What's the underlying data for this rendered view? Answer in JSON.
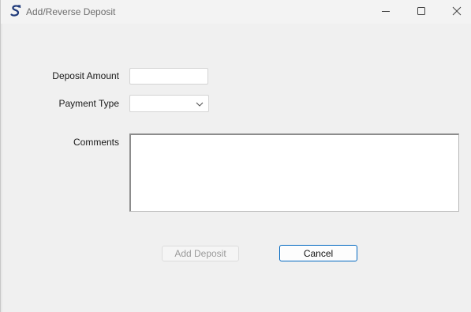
{
  "window": {
    "title": "Add/Reverse Deposit",
    "controls": [
      "minimize-icon",
      "maximize-icon",
      "close-icon"
    ]
  },
  "form": {
    "deposit_amount_label": "Deposit Amount",
    "deposit_amount_value": "",
    "payment_type_label": "Payment Type",
    "payment_type_value": "",
    "comments_label": "Comments",
    "comments_value": ""
  },
  "buttons": {
    "add_deposit_label": "Add Deposit",
    "add_deposit_enabled": false,
    "cancel_label": "Cancel"
  },
  "colors": {
    "accent": "#0067c0",
    "background": "#f0f0f0",
    "disabled_text": "#9a9a9a"
  }
}
